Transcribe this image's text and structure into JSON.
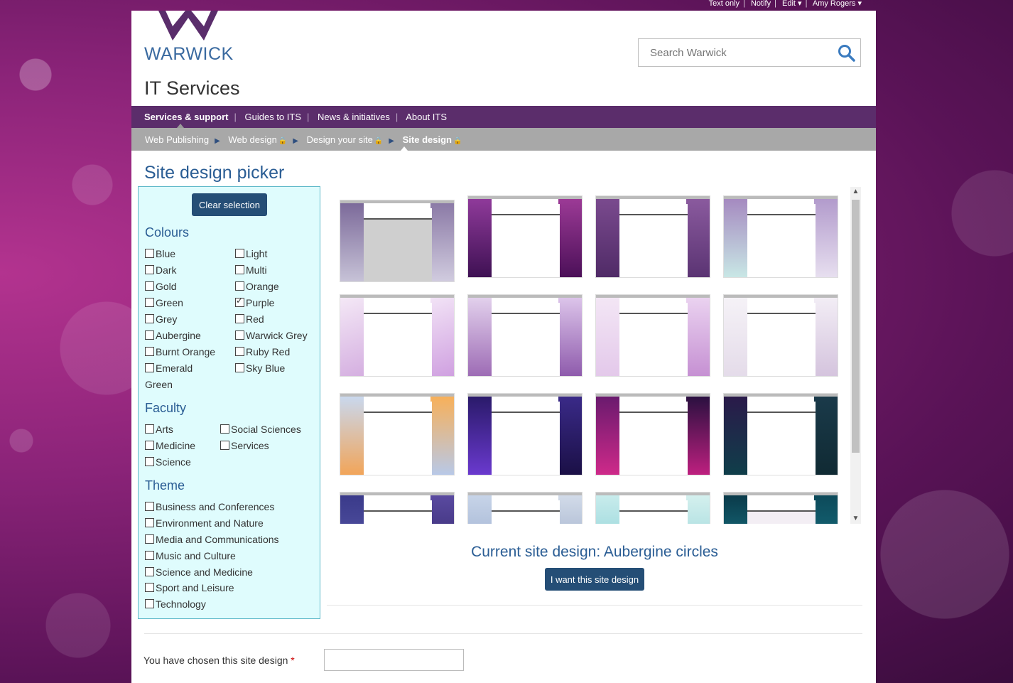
{
  "util": {
    "text_only": "Text only",
    "notify": "Notify",
    "edit": "Edit",
    "user": "Amy Rogers"
  },
  "brand": {
    "logo_text": "WARWICK",
    "site_title": "IT Services",
    "colors": {
      "nav": "#5b2d6b",
      "crumbs": "#a8a8a8",
      "heading": "#2a5d94",
      "button": "#254e76"
    }
  },
  "search": {
    "placeholder": "Search Warwick",
    "icon": "search-icon"
  },
  "nav": [
    "Services & support",
    "Guides to ITS",
    "News & initiatives",
    "About ITS"
  ],
  "crumbs": [
    "Web Publishing",
    "Web design",
    "Design your site",
    "Site design"
  ],
  "page": {
    "title": "Site design picker"
  },
  "filters": {
    "clear_label": "Clear selection",
    "colours_heading": "Colours",
    "colours_left": [
      "Blue",
      "Dark",
      "Gold",
      "Green",
      "Grey",
      "Aubergine",
      "Burnt Orange",
      "Emerald"
    ],
    "colours_left_wrap": "Green",
    "colours_right": [
      "Light",
      "Multi",
      "Orange",
      "Purple",
      "Red",
      "Warwick Grey",
      "Ruby Red",
      "Sky Blue"
    ],
    "checked": "Purple",
    "faculty_heading": "Faculty",
    "faculty_left": [
      "Arts",
      "Medicine",
      "Science"
    ],
    "faculty_right": [
      "Social Sciences",
      "Services"
    ],
    "theme_heading": "Theme",
    "themes": [
      "Business and Conferences",
      "Environment and Nature",
      "Media and Communications",
      "Music and Culture",
      "Science and Medicine",
      "Sport and Leisure",
      "Technology"
    ]
  },
  "current_design": "Current site design: Aubergine circles",
  "want_label": "I want this site design",
  "chosen_label": "You have chosen this site design",
  "required_mark": "*"
}
